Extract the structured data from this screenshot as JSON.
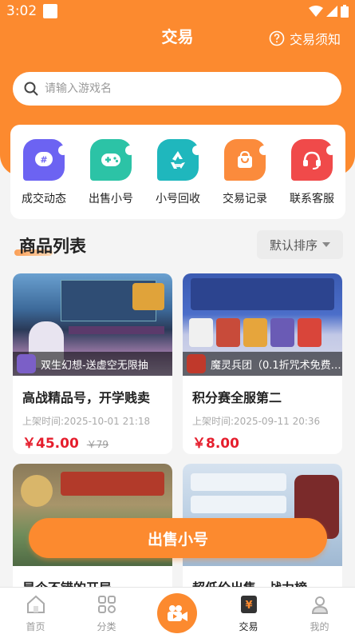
{
  "status": {
    "time": "3:02"
  },
  "header": {
    "title": "交易",
    "notice": "交易须知"
  },
  "search": {
    "placeholder": "请输入游戏名"
  },
  "quick": [
    {
      "label": "成交动态",
      "icon": "hashtag-chat-icon",
      "color": "#6c63f2"
    },
    {
      "label": "出售小号",
      "icon": "gamepad-icon",
      "color": "#2cc3a6"
    },
    {
      "label": "小号回收",
      "icon": "recycle-icon",
      "color": "#1fb7bd"
    },
    {
      "label": "交易记录",
      "icon": "shopping-bag-icon",
      "color": "#fb8b3c"
    },
    {
      "label": "联系客服",
      "icon": "headset-icon",
      "color": "#f04a4a"
    }
  ],
  "section": {
    "title": "商品列表",
    "sort_label": "默认排序"
  },
  "products": [
    {
      "game": "双生幻想-送虚空无限抽",
      "title": "高战精品号，开学贱卖",
      "date": "上架时间:2025-10-01 21:18",
      "price": "￥45.00",
      "old_price": "￥79"
    },
    {
      "game": "魔灵兵团（0.1折咒术免费…",
      "title": "积分赛全服第二",
      "date": "上架时间:2025-09-11 20:36",
      "price": "￥8.00",
      "old_price": ""
    },
    {
      "game": "",
      "title": "是个不错的开局",
      "date": "",
      "price": "",
      "old_price": ""
    },
    {
      "game": "",
      "title": "超低价出售，战力榜",
      "date": "",
      "price": "",
      "old_price": ""
    }
  ],
  "sell_button": "出售小号",
  "tabs": [
    {
      "label": "首页",
      "icon": "home-icon"
    },
    {
      "label": "分类",
      "icon": "category-icon"
    },
    {
      "label": "",
      "icon": "video-camera-icon"
    },
    {
      "label": "交易",
      "icon": "trade-icon"
    },
    {
      "label": "我的",
      "icon": "user-icon"
    }
  ],
  "colors": {
    "accent": "#fc8a2f",
    "price": "#e51e2d"
  }
}
